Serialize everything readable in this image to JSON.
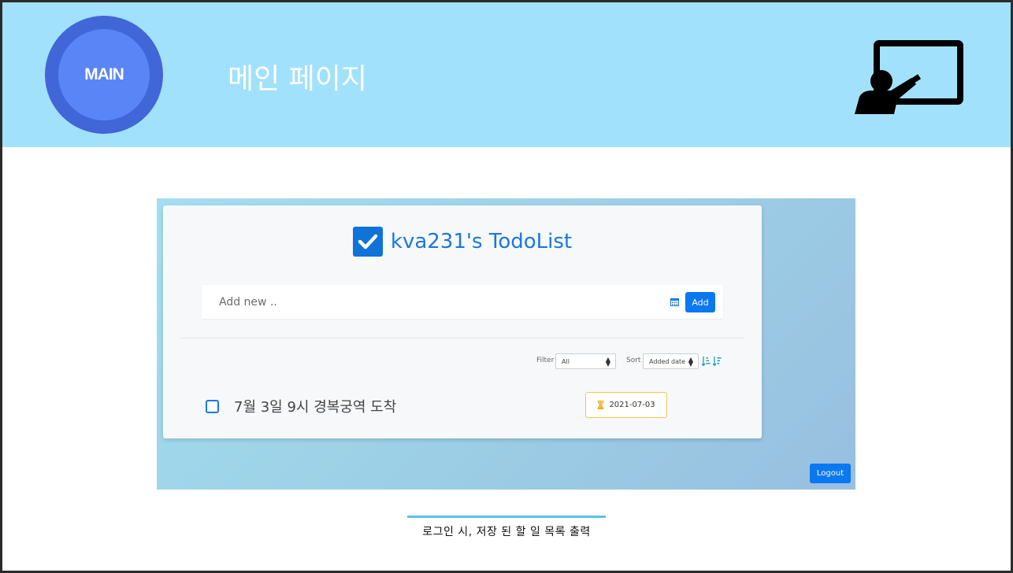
{
  "header": {
    "badge_label": "MAIN",
    "title": "메인 페이지",
    "background": "#a1e1fc"
  },
  "app": {
    "title": "kva231's TodoList",
    "add_input": {
      "placeholder": "Add new ..",
      "value": ""
    },
    "add_button": "Add",
    "filter": {
      "label": "Filter",
      "selected": "All"
    },
    "sort": {
      "label": "Sort",
      "selected": "Added date"
    },
    "todos": [
      {
        "text": "7월 3일 9시 경복궁역 도착",
        "checked": false,
        "due_date": "2021-07-03"
      }
    ],
    "logout_button": "Logout",
    "accent_color": "#0a78f0"
  },
  "caption": "로그인 시, 저장 된 할 일 목록 출력",
  "icons": {
    "header_right": "teacher-presentation-icon",
    "title_check": "checkbox-checked-icon",
    "calendar": "calendar-icon",
    "due": "hourglass-icon",
    "sort_asc": "sort-ascending-icon",
    "sort_desc": "sort-descending-icon"
  }
}
